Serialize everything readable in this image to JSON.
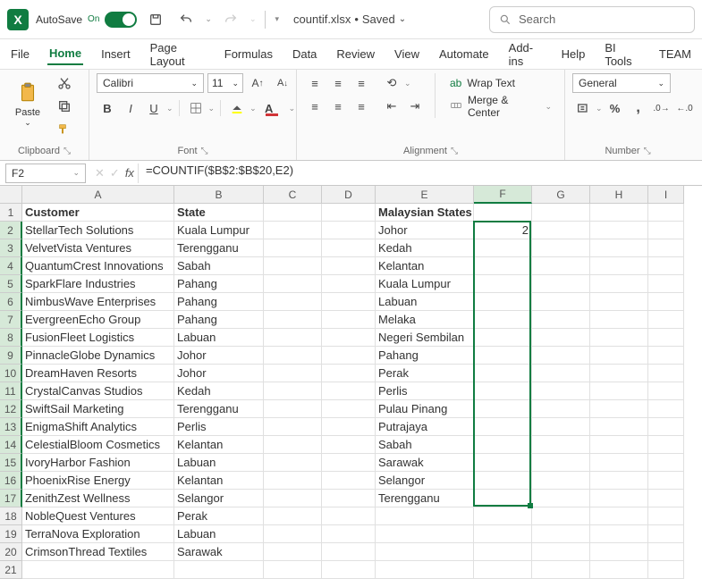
{
  "titlebar": {
    "autosave_label": "AutoSave",
    "autosave_state": "On",
    "filename": "countif.xlsx",
    "save_state": "Saved",
    "search_placeholder": "Search"
  },
  "tabs": [
    "File",
    "Home",
    "Insert",
    "Page Layout",
    "Formulas",
    "Data",
    "Review",
    "View",
    "Automate",
    "Add-ins",
    "Help",
    "BI Tools",
    "TEAM"
  ],
  "active_tab": "Home",
  "ribbon": {
    "clipboard": {
      "label": "Clipboard",
      "paste": "Paste"
    },
    "font": {
      "label": "Font",
      "name": "Calibri",
      "size": "11",
      "bold": "B",
      "italic": "I",
      "underline": "U"
    },
    "alignment": {
      "label": "Alignment",
      "wrap": "Wrap Text",
      "merge": "Merge & Center"
    },
    "number": {
      "label": "Number",
      "format": "General"
    }
  },
  "formula_bar": {
    "name_box": "F2",
    "formula": "=COUNTIF($B$2:$B$20,E2)"
  },
  "columns": [
    "A",
    "B",
    "C",
    "D",
    "E",
    "F",
    "G",
    "H",
    "I"
  ],
  "selection": {
    "col": "F",
    "row_start": 2,
    "row_end": 17
  },
  "headers": {
    "A": "Customer",
    "B": "State",
    "E": "Malaysian States"
  },
  "rows": [
    {
      "n": 2,
      "A": "StellarTech Solutions",
      "B": "Kuala Lumpur",
      "E": "Johor",
      "F": "2"
    },
    {
      "n": 3,
      "A": "VelvetVista Ventures",
      "B": "Terengganu",
      "E": "Kedah"
    },
    {
      "n": 4,
      "A": "QuantumCrest Innovations",
      "B": "Sabah",
      "E": "Kelantan"
    },
    {
      "n": 5,
      "A": "SparkFlare Industries",
      "B": "Pahang",
      "E": "Kuala Lumpur"
    },
    {
      "n": 6,
      "A": "NimbusWave Enterprises",
      "B": "Pahang",
      "E": "Labuan"
    },
    {
      "n": 7,
      "A": "EvergreenEcho Group",
      "B": "Pahang",
      "E": "Melaka"
    },
    {
      "n": 8,
      "A": "FusionFleet Logistics",
      "B": "Labuan",
      "E": "Negeri Sembilan"
    },
    {
      "n": 9,
      "A": "PinnacleGlobe Dynamics",
      "B": "Johor",
      "E": "Pahang"
    },
    {
      "n": 10,
      "A": "DreamHaven Resorts",
      "B": "Johor",
      "E": "Perak"
    },
    {
      "n": 11,
      "A": "CrystalCanvas Studios",
      "B": "Kedah",
      "E": "Perlis"
    },
    {
      "n": 12,
      "A": "SwiftSail Marketing",
      "B": "Terengganu",
      "E": "Pulau Pinang"
    },
    {
      "n": 13,
      "A": "EnigmaShift Analytics",
      "B": "Perlis",
      "E": "Putrajaya"
    },
    {
      "n": 14,
      "A": "CelestialBloom Cosmetics",
      "B": "Kelantan",
      "E": "Sabah"
    },
    {
      "n": 15,
      "A": "IvoryHarbor Fashion",
      "B": "Labuan",
      "E": "Sarawak"
    },
    {
      "n": 16,
      "A": "PhoenixRise Energy",
      "B": "Kelantan",
      "E": "Selangor"
    },
    {
      "n": 17,
      "A": "ZenithZest Wellness",
      "B": "Selangor",
      "E": "Terengganu"
    },
    {
      "n": 18,
      "A": "NobleQuest Ventures",
      "B": "Perak"
    },
    {
      "n": 19,
      "A": "TerraNova Exploration",
      "B": "Labuan"
    },
    {
      "n": 20,
      "A": "CrimsonThread Textiles",
      "B": "Sarawak"
    },
    {
      "n": 21
    }
  ]
}
